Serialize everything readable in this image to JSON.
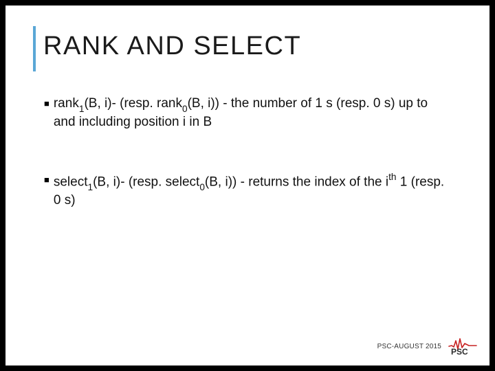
{
  "title": "RANK AND SELECT",
  "bullets": [
    {
      "parts": [
        {
          "t": "rank"
        },
        {
          "t": "1",
          "cls": "sub"
        },
        {
          "t": "(B, i)- (resp. rank"
        },
        {
          "t": "0",
          "cls": "sub"
        },
        {
          "t": "(B, i)) - the number of 1 s (resp. 0 s) up to and including position i in B"
        }
      ]
    },
    {
      "parts": [
        {
          "t": "select"
        },
        {
          "t": "1",
          "cls": "sub"
        },
        {
          "t": "(B, i)- (resp. select"
        },
        {
          "t": "0",
          "cls": "sub"
        },
        {
          "t": "(B, i)) - returns the index of the i"
        },
        {
          "t": "th",
          "cls": "sup"
        },
        {
          "t": " 1 (resp. 0 s)"
        }
      ]
    }
  ],
  "footer": {
    "text": "PSC-AUGUST 2015",
    "logo_label": "PSC",
    "accent_color": "#c62020"
  },
  "colors": {
    "accent_bar": "#5aa7d6"
  }
}
